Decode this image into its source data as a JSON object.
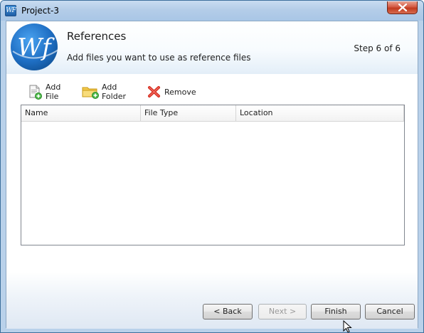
{
  "window": {
    "title": "Project-3",
    "app_icon_text": "WF"
  },
  "header": {
    "logo_text": "Wf",
    "title": "References",
    "subtitle": "Add files you want to use as reference files",
    "step": "Step 6 of 6"
  },
  "toolbar": {
    "add_file": "Add File",
    "add_folder": "Add Folder",
    "remove": "Remove"
  },
  "list": {
    "columns": [
      "Name",
      "File Type",
      "Location"
    ],
    "rows": []
  },
  "footer": {
    "back": "< Back",
    "next": "Next >",
    "finish": "Finish",
    "cancel": "Cancel"
  },
  "colors": {
    "brand_blue": "#1f6fc4",
    "remove_red": "#d42b1e",
    "folder_yellow": "#f2c94c"
  }
}
